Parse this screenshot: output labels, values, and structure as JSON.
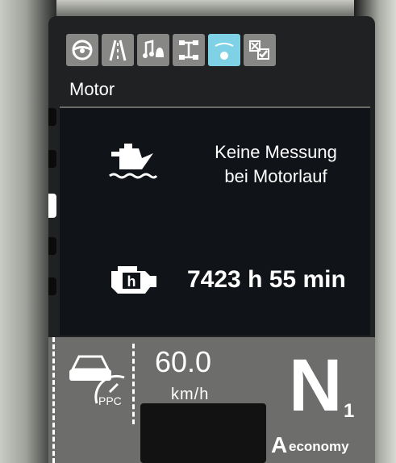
{
  "header": {
    "tabs": [
      {
        "icon": "steering-wheel-icon",
        "active": false
      },
      {
        "icon": "road-icon",
        "active": false
      },
      {
        "icon": "music-bell-icon",
        "active": false
      },
      {
        "icon": "drivetrain-icon",
        "active": false
      },
      {
        "icon": "vehicle-info-icon",
        "active": true
      },
      {
        "icon": "settings-checklist-icon",
        "active": false
      }
    ]
  },
  "section": {
    "title": "Motor"
  },
  "main": {
    "oil_message_line1": "Keine Messung",
    "oil_message_line2": "bei Motorlauf",
    "engine_hours": "7423 h 55 min"
  },
  "bottom": {
    "ppc_label": "PPC",
    "speed": "60.0",
    "speed_unit": "km/h",
    "gear": "N",
    "gear_index": "1",
    "mode_letter": "A",
    "mode_name": "economy"
  },
  "colors": {
    "active_tab": "#7fd2e6",
    "tab_bg": "#878885",
    "panel_bg": "#101418",
    "bottom_bg": "#6d6e6c"
  }
}
